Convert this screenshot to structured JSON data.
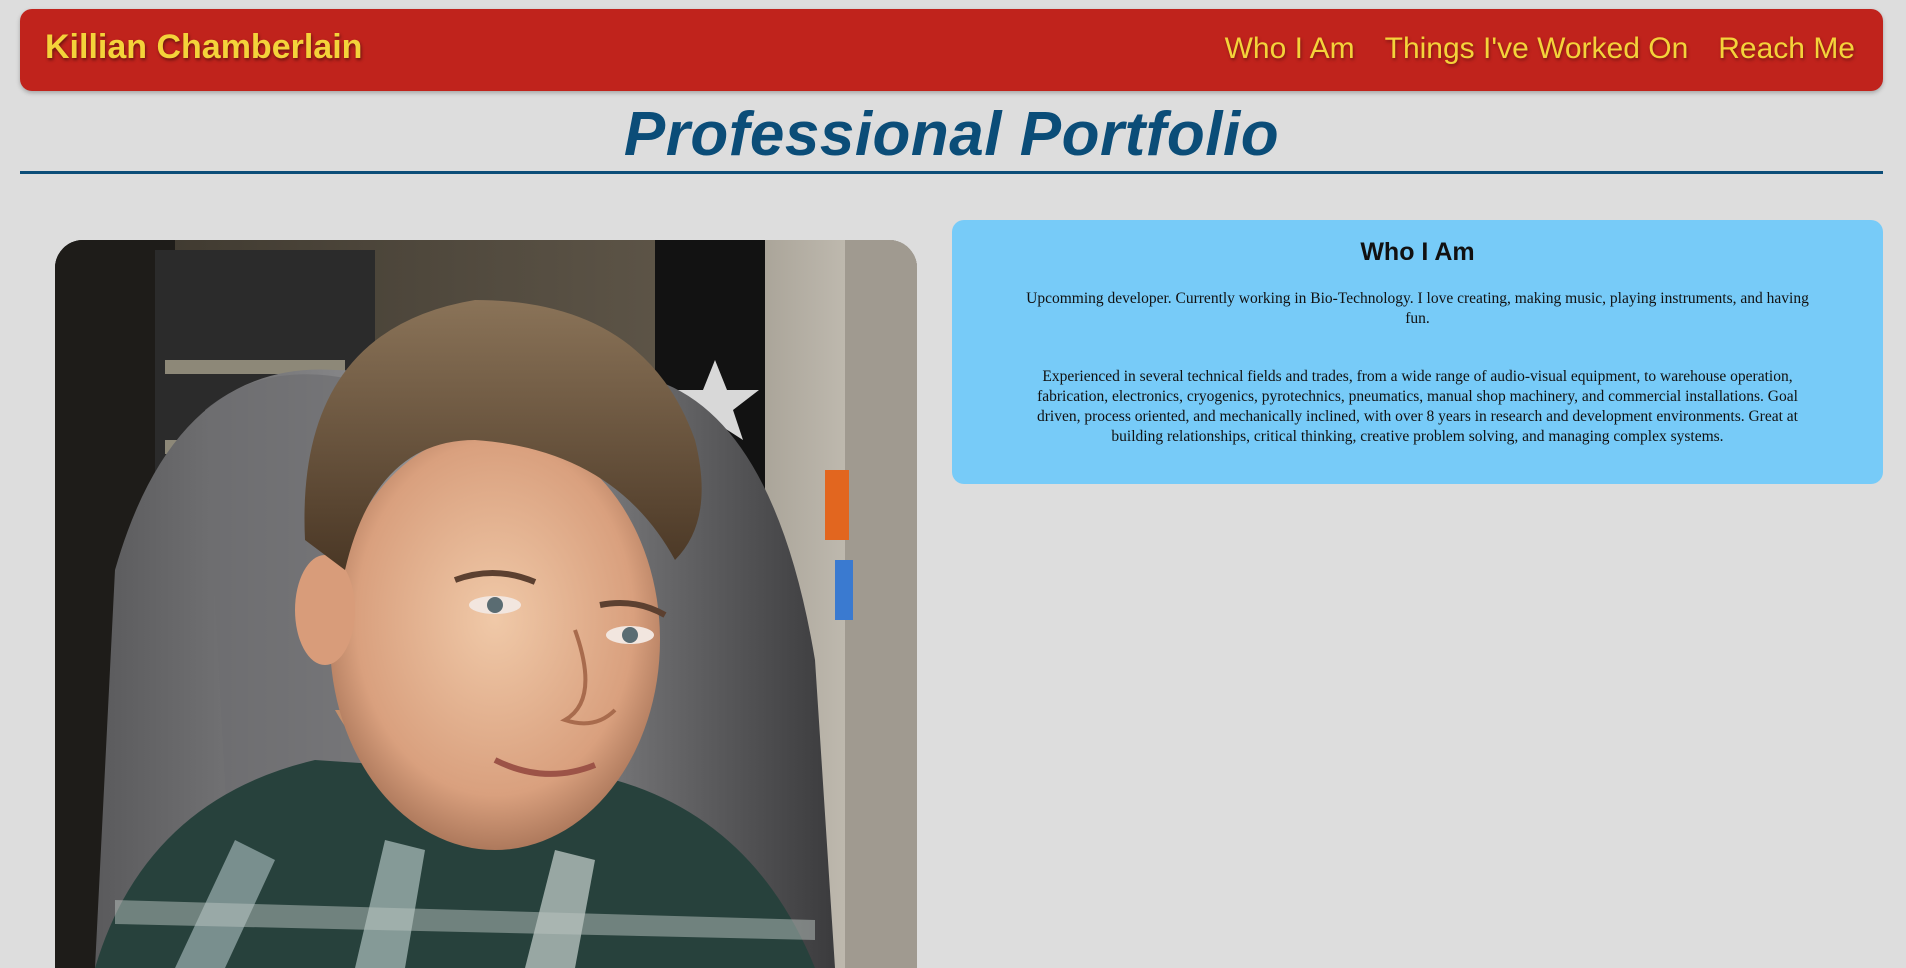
{
  "header": {
    "brand": "Killian Chamberlain",
    "nav": [
      {
        "label": "Who I Am"
      },
      {
        "label": "Things I've Worked On"
      },
      {
        "label": "Reach Me"
      }
    ]
  },
  "page_title": "Professional Portfolio",
  "about": {
    "heading": "Who I Am",
    "paragraphs": [
      "Upcomming developer. Currently working in Bio-Technology. I love creating, making music, playing instruments, and having fun.",
      "Experienced in several technical fields and trades, from a wide range of audio-visual equipment, to warehouse operation, fabrication, electronics, cryogenics, pyrotechnics, pneumatics, manual shop machinery, and commercial installations. Goal driven, process oriented, and mechanically inclined, with over 8 years in research and development environments. Great at building relationships, critical thinking, creative problem solving, and managing complex systems."
    ]
  },
  "colors": {
    "nav_background": "#c0231c",
    "nav_text": "#f4d33a",
    "title": "#0b4d78",
    "card_background": "#77cbf8",
    "page_background": "#dddddd"
  }
}
